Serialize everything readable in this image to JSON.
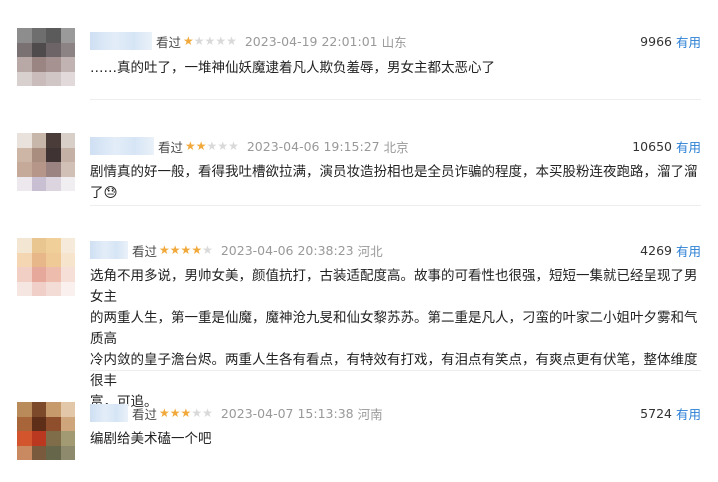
{
  "reviews": [
    {
      "watched_label": "看过",
      "rating": 1,
      "time": "2023-04-19 22:01:01",
      "location": "山东",
      "votes": "9966",
      "useful_label": "有用",
      "content": "……真的吐了，一堆神仙妖魔逮着凡人欺负羞辱，男女主都太恶心了"
    },
    {
      "watched_label": "看过",
      "rating": 2,
      "time": "2023-04-06 19:15:27",
      "location": "北京",
      "votes": "10650",
      "useful_label": "有用",
      "content": "剧情真的好一般，看得我吐槽欲拉满，演员妆造扮相也是全员诈骗的程度，本买股粉连夜跑路，溜了溜了😓"
    },
    {
      "watched_label": "看过",
      "rating": 4,
      "time": "2023-04-06 20:38:23",
      "location": "河北",
      "votes": "4269",
      "useful_label": "有用",
      "content_lines": [
        "选角不用多说，男帅女美，颜值抗打，古装适配度高。故事的可看性也很强，短短一集就已经呈现了男女主",
        "的两重人生，第一重是仙魔，魔神沧九旻和仙女黎苏苏。第二重是凡人，刁蛮的叶家二小姐叶夕雾和气质高",
        "冷内敛的皇子澹台烬。两重人生各有看点，有特效有打戏，有泪点有笑点，有爽点更有伏笔，整体维度很丰",
        "富，可追。"
      ]
    },
    {
      "watched_label": "看过",
      "rating": 3,
      "time": "2023-04-07 15:13:38",
      "location": "河南",
      "votes": "5724",
      "useful_label": "有用",
      "content": "编剧给美术磕一个吧"
    }
  ],
  "colors": {
    "star_on": "#f1a93b",
    "star_off": "#d9d9d9",
    "useful_link": "#2a7fd4",
    "meta_text": "#999999"
  }
}
